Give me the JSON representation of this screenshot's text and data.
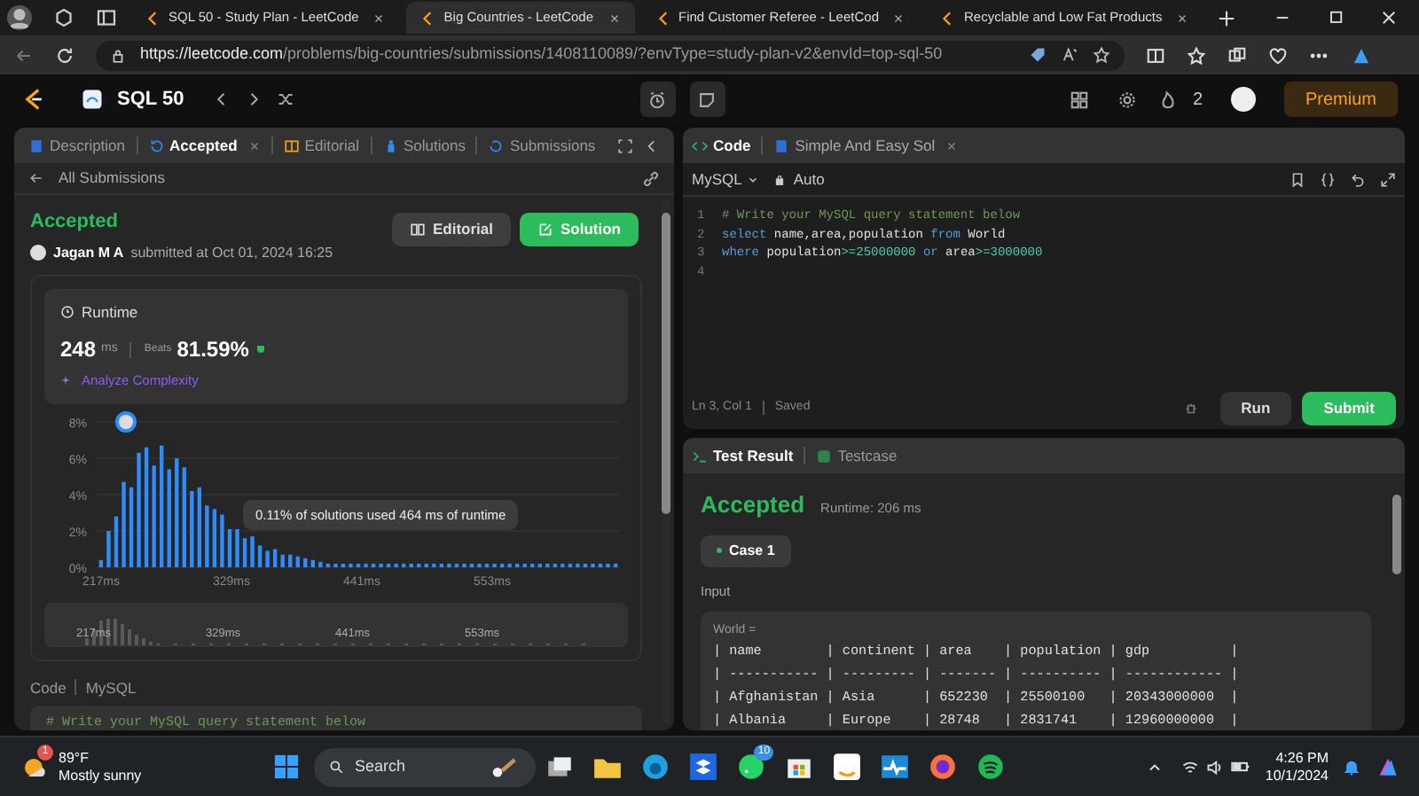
{
  "browser": {
    "tabs": [
      {
        "title": "SQL 50 - Study Plan - LeetCode",
        "selected": false
      },
      {
        "title": "Big Countries - LeetCode",
        "selected": true
      },
      {
        "title": "Find Customer Referee - LeetCod",
        "selected": false
      },
      {
        "title": "Recyclable and Low Fat Products",
        "selected": false
      }
    ],
    "url_host": "https://leetcode.com",
    "url_path": "/problems/big-countries/submissions/1408110089/?envType=study-plan-v2&envId=top-sql-50"
  },
  "nav": {
    "title": "SQL 50",
    "streak": "2",
    "premium": "Premium"
  },
  "left_panel": {
    "tabs": [
      {
        "label": "Description",
        "selected": false,
        "closable": false
      },
      {
        "label": "Accepted",
        "selected": true,
        "closable": true
      },
      {
        "label": "Editorial",
        "selected": false,
        "closable": false
      },
      {
        "label": "Solutions",
        "selected": false,
        "closable": false
      },
      {
        "label": "Submissions",
        "selected": false,
        "closable": false
      }
    ],
    "back_link": "All Submissions",
    "status": "Accepted",
    "author": "Jagan M A",
    "submitted": "submitted at Oct 01, 2024 16:25",
    "editorial_button": "Editorial",
    "solution_button": "Solution",
    "runtime": {
      "title": "Runtime",
      "value": "248",
      "unit": "ms",
      "beats_label": "Beats",
      "beats": "81.59%",
      "analyze": "Analyze Complexity",
      "chart_data": {
        "type": "bar",
        "x": [
          217,
          223.5,
          230,
          236.5,
          243,
          249.5,
          256,
          262.5,
          269,
          275.5,
          282,
          288.5,
          295,
          301.5,
          308,
          314.5,
          321,
          327.5,
          334,
          340.5,
          347,
          353.5,
          360,
          366.5,
          373,
          379.5,
          386,
          392.5,
          399,
          405.5,
          412,
          418.5,
          425,
          431.5,
          438,
          444.5,
          451,
          457.5,
          464,
          470.5,
          477,
          483.5,
          490,
          496.5,
          503,
          509.5,
          516,
          522.5,
          529,
          535.5,
          542,
          548.5,
          555,
          561.5,
          568,
          574.5,
          581,
          587.5,
          594,
          600.5,
          607,
          613.5,
          620,
          626.5,
          633,
          639.5,
          646,
          652.5,
          659
        ],
        "grid": true,
        "series": [
          {
            "color": "#2f8cff",
            "values": [
              0.4,
              2.0,
              2.8,
              4.7,
              4.4,
              6.3,
              6.6,
              5.6,
              6.7,
              5.4,
              6.0,
              5.5,
              4.2,
              4.4,
              3.4,
              3.2,
              2.9,
              2.1,
              2.1,
              1.6,
              1.7,
              1.2,
              0.9,
              1.0,
              0.7,
              0.7,
              0.6,
              0.5,
              0.4,
              0.3,
              0.2,
              0.2,
              0.2,
              0.2,
              0.2,
              0.2,
              0.2,
              0.2,
              0.2,
              0.2,
              0.2,
              0.2,
              0.2,
              0.2,
              0.2,
              0.2,
              0.2,
              0.2,
              0.2,
              0.2,
              0.2,
              0.2,
              0.2,
              0.2,
              0.2,
              0.2,
              0.2,
              0.2,
              0.2,
              0.2,
              0.2,
              0.2,
              0.2,
              0.2,
              0.2,
              0.2,
              0.2,
              0.2,
              0.2
            ]
          }
        ],
        "xlim": [
          214,
          662
        ],
        "ylim": [
          0,
          8
        ],
        "xticks": [
          {
            "value": 217,
            "label": "217ms"
          },
          {
            "value": 329,
            "label": "329ms"
          },
          {
            "value": 441,
            "label": "441ms"
          },
          {
            "value": 553,
            "label": "553ms"
          }
        ],
        "yticks": [
          {
            "value": 0,
            "label": "0%"
          },
          {
            "value": 2,
            "label": "2%"
          },
          {
            "value": 4,
            "label": "4%"
          },
          {
            "value": 6,
            "label": "6%"
          },
          {
            "value": 8,
            "label": "8%"
          }
        ],
        "annotations": [
          "0.11% of solutions used 464 ms of runtime"
        ]
      },
      "navigator_labels": [
        "217ms",
        "329ms",
        "441ms",
        "553ms"
      ]
    },
    "code_label": "Code",
    "code_language": "MySQL",
    "code_preview": "# Write your MySQL query statement below"
  },
  "editor": {
    "tabs": [
      {
        "label": "Code",
        "selected": true,
        "closable": false
      },
      {
        "label": "Simple And Easy Sol",
        "selected": false,
        "closable": true
      }
    ],
    "language": "MySQL",
    "mode": "Auto",
    "lines": [
      {
        "number": "1",
        "tokens": [
          {
            "kind": "comment",
            "text": "# Write your MySQL query statement below"
          }
        ]
      },
      {
        "number": "2",
        "tokens": [
          {
            "kind": "keyword",
            "text": "select"
          },
          {
            "kind": "plain",
            "text": " name,area,population "
          },
          {
            "kind": "keyword",
            "text": "from"
          },
          {
            "kind": "plain",
            "text": " World"
          }
        ]
      },
      {
        "number": "3",
        "tokens": [
          {
            "kind": "keyword",
            "text": "where"
          },
          {
            "kind": "plain",
            "text": " population"
          },
          {
            "kind": "number",
            "text": ">=25000000"
          },
          {
            "kind": "keyword",
            "text": " or"
          },
          {
            "kind": "plain",
            "text": " area"
          },
          {
            "kind": "number",
            "text": ">=3000000"
          }
        ]
      },
      {
        "number": "4"
      }
    ],
    "cursor": "Ln 3, Col 1",
    "saved": "Saved",
    "run": "Run",
    "submit": "Submit"
  },
  "result": {
    "tabs": [
      {
        "label": "Test Result",
        "selected": true
      },
      {
        "label": "Testcase",
        "selected": false
      }
    ],
    "status": "Accepted",
    "runtime": "Runtime: 206 ms",
    "cases": [
      {
        "label": "Case 1",
        "selected": true
      }
    ],
    "input_label": "Input",
    "variable": "World =",
    "table_lines": [
      "| name        | continent | area    | population | gdp          |",
      "| ----------- | --------- | ------- | ---------- | ------------ |",
      "| Afghanistan | Asia      | 652230  | 25500100   | 20343000000  |",
      "| Albania     | Europe    | 28748   | 2831741    | 12960000000  |"
    ]
  },
  "taskbar": {
    "weather_badge": "1",
    "temperature": "89°F",
    "weather": "Mostly sunny",
    "search": "Search",
    "chat_badge": "10",
    "time": "4:26 PM",
    "date": "10/1/2024"
  }
}
